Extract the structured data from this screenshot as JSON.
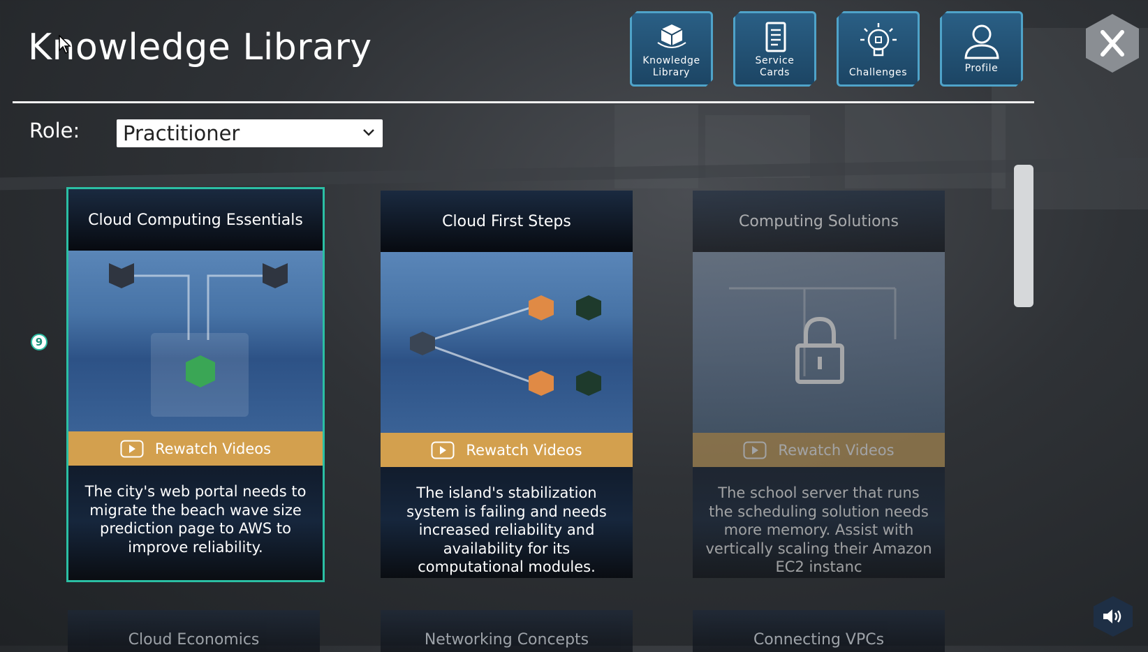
{
  "header": {
    "title": "Knowledge Library"
  },
  "nav": [
    {
      "label": "Knowledge\nLibrary",
      "icon": "cube-icon"
    },
    {
      "label": "Service\nCards",
      "icon": "document-icon"
    },
    {
      "label": "Challenges",
      "icon": "lightbulb-icon"
    },
    {
      "label": "Profile",
      "icon": "user-icon"
    }
  ],
  "filter": {
    "role_label": "Role:",
    "role_value": "Practitioner"
  },
  "notification_count": "9",
  "cards": [
    {
      "title": "Cloud Computing Essentials",
      "button": "Rewatch Videos",
      "description": "The city's web portal needs to migrate the beach wave size prediction page to AWS to improve reliability.",
      "locked": false,
      "selected": true
    },
    {
      "title": "Cloud First Steps",
      "button": "Rewatch Videos",
      "description": "The island's stabilization system is failing and needs increased reliability and availability for its computational modules.",
      "locked": false,
      "selected": false
    },
    {
      "title": "Computing Solutions",
      "button": "Rewatch Videos",
      "description": "The school server that runs the scheduling solution needs more memory. Assist with vertically scaling their Amazon EC2 instanc",
      "locked": true,
      "selected": false
    }
  ],
  "cards_next_row": [
    {
      "title": "Cloud Economics"
    },
    {
      "title": "Networking Concepts"
    },
    {
      "title": "Connecting VPCs"
    }
  ],
  "colors": {
    "accent": "#2bbfa4",
    "button_gold": "#d3a04e",
    "nav_blue": "#2a5f85"
  }
}
